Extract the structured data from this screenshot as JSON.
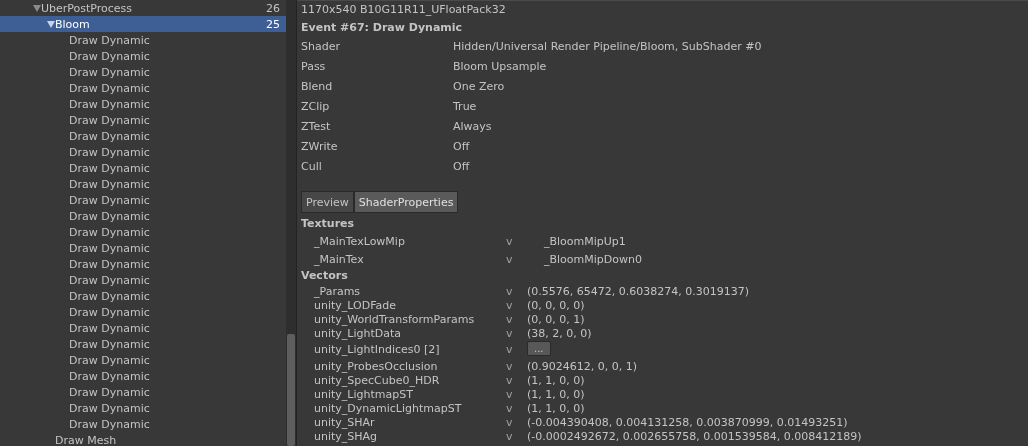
{
  "tree": [
    {
      "label": "UberPostProcess",
      "count": "26",
      "expanded": true,
      "selected": false,
      "children": [
        {
          "label": "Bloom",
          "count": "25",
          "expanded": true,
          "selected": true,
          "children": [
            {
              "label": "Draw Dynamic",
              "selected": false
            },
            {
              "label": "Draw Dynamic",
              "selected": false
            },
            {
              "label": "Draw Dynamic",
              "selected": false
            },
            {
              "label": "Draw Dynamic",
              "selected": false
            },
            {
              "label": "Draw Dynamic",
              "selected": false
            },
            {
              "label": "Draw Dynamic",
              "selected": false
            },
            {
              "label": "Draw Dynamic",
              "selected": false
            },
            {
              "label": "Draw Dynamic",
              "selected": false
            },
            {
              "label": "Draw Dynamic",
              "selected": false
            },
            {
              "label": "Draw Dynamic",
              "selected": false
            },
            {
              "label": "Draw Dynamic",
              "selected": false
            },
            {
              "label": "Draw Dynamic",
              "selected": false
            },
            {
              "label": "Draw Dynamic",
              "selected": false
            },
            {
              "label": "Draw Dynamic",
              "selected": false
            },
            {
              "label": "Draw Dynamic",
              "selected": false
            },
            {
              "label": "Draw Dynamic",
              "selected": false
            },
            {
              "label": "Draw Dynamic",
              "selected": false
            },
            {
              "label": "Draw Dynamic",
              "selected": false
            },
            {
              "label": "Draw Dynamic",
              "selected": false
            },
            {
              "label": "Draw Dynamic",
              "selected": false
            },
            {
              "label": "Draw Dynamic",
              "selected": false
            },
            {
              "label": "Draw Dynamic",
              "selected": false
            },
            {
              "label": "Draw Dynamic",
              "selected": false
            },
            {
              "label": "Draw Dynamic",
              "selected": false
            },
            {
              "label": "Draw Dynamic",
              "selected": false
            }
          ]
        },
        {
          "label": "Draw Mesh",
          "selected": false
        }
      ]
    }
  ],
  "details": {
    "target_info": "1170x540 B10G11R11_UFloatPack32",
    "event_title": "Event #67: Draw Dynamic",
    "properties": [
      {
        "name": "Shader",
        "value": "Hidden/Universal Render Pipeline/Bloom, SubShader #0"
      },
      {
        "name": "Pass",
        "value": "Bloom Upsample"
      },
      {
        "name": "Blend",
        "value": "One Zero"
      },
      {
        "name": "ZClip",
        "value": "True"
      },
      {
        "name": "ZTest",
        "value": "Always"
      },
      {
        "name": "ZWrite",
        "value": "Off"
      },
      {
        "name": "Cull",
        "value": "Off"
      }
    ],
    "tabs": [
      {
        "label": "Preview",
        "selected": false
      },
      {
        "label": "ShaderProperties",
        "selected": true
      }
    ],
    "sections": [
      {
        "title": "Textures",
        "kind": "textures",
        "rows": [
          {
            "name": "_MainTexLowMip",
            "toggle": "v",
            "value": "_BloomMipUp1"
          },
          {
            "name": "_MainTex",
            "toggle": "v",
            "value": "_BloomMipDown0"
          }
        ]
      },
      {
        "title": "Vectors",
        "kind": "vectors",
        "rows": [
          {
            "name": "_Params",
            "toggle": "v",
            "value": "(0.5576, 65472, 0.6038274, 0.3019137)"
          },
          {
            "name": "unity_LODFade",
            "toggle": "v",
            "value": "(0, 0, 0, 0)"
          },
          {
            "name": "unity_WorldTransformParams",
            "toggle": "v",
            "value": "(0, 0, 0, 1)"
          },
          {
            "name": "unity_LightData",
            "toggle": "v",
            "value": "(38, 2, 0, 0)"
          },
          {
            "name": "unity_LightIndices0 [2]",
            "toggle": "v",
            "button": "..."
          },
          {
            "name": "unity_ProbesOcclusion",
            "toggle": "v",
            "value": "(0.9024612, 0, 0, 1)"
          },
          {
            "name": "unity_SpecCube0_HDR",
            "toggle": "v",
            "value": "(1, 1, 0, 0)"
          },
          {
            "name": "unity_LightmapST",
            "toggle": "v",
            "value": "(1, 1, 0, 0)"
          },
          {
            "name": "unity_DynamicLightmapST",
            "toggle": "v",
            "value": "(1, 1, 0, 0)"
          },
          {
            "name": "unity_SHAr",
            "toggle": "v",
            "value": "(-0.004390408, 0.004131258, 0.003870999, 0.01493251)"
          },
          {
            "name": "unity_SHAg",
            "toggle": "v",
            "value": "(-0.0002492672, 0.002655758, 0.001539584, 0.008412189)"
          }
        ]
      }
    ]
  }
}
